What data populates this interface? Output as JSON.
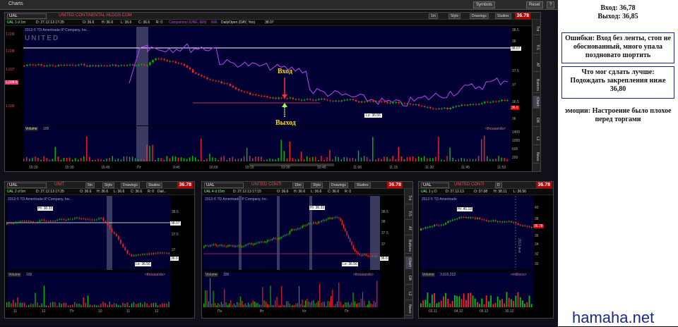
{
  "app": {
    "title": "Charts",
    "symbols_label": "Symbols",
    "reset_label": "Reset",
    "help_label": "?"
  },
  "main_panel": {
    "symbol": "UAL",
    "company": "UNITED CONTINENTAL HLDGS COM",
    "last_price": "36.78",
    "aggregation": "1m",
    "style_label": "Style",
    "drawings_label": "Drawings",
    "studies_label": "Studies",
    "info": {
      "period": "UAL 1 d 1m",
      "date": "D: 27.12.13 17:25",
      "open": "O: 36.6",
      "high": "H: 36.6",
      "low": "L: 36.6",
      "close": "C: 36.6",
      "r": "R: 0",
      "comparison": "Comparison (UNE, IEN)",
      "na": "N/A",
      "daily_open": "DailyOpen (DAY, Yes)",
      "daily_open_value": "38.07"
    },
    "copyright": "2013 © TD Ameritrade IP Company, Inc.",
    "watermark_text": "UNITED",
    "low_label": "Lo: 36.56",
    "volume_label": "Volume",
    "volume_value": "100",
    "thousands": "<thousands>",
    "left_price": "1,038.5",
    "time_ticks": [
      "15:20",
      "15:30",
      "15:45",
      "Пт",
      "9:45",
      "10:00",
      "10:15",
      "10:30",
      "10:45",
      "11:00",
      "11:15",
      "11:30",
      "11:45",
      "11:53"
    ],
    "price_ticks": [
      "38.5",
      "38",
      "38.07",
      "37.5",
      "37",
      "36.5",
      "36.6",
      "36"
    ],
    "left_ticks": [
      "1,039",
      "1,038",
      "1,037",
      "1,036",
      "1,035"
    ],
    "vol_ticks": [
      "1400",
      "1200",
      "1000",
      "800",
      "600",
      "400",
      "200",
      "100"
    ],
    "side_tabs": [
      "Trd",
      "TIS",
      "AT",
      "Buttons",
      "Chart",
      "DB",
      "L2",
      "News"
    ],
    "annotation_entry": "Вход",
    "annotation_exit": "Выход"
  },
  "panel_2d": {
    "symbol": "UAL",
    "company": "UNIT",
    "last_price": "36.78",
    "aggregation": "5m",
    "style_label": "Style",
    "drawings_label": "Drawings",
    "studies_label": "Studies",
    "info": {
      "period": "UAL 2 d 5m",
      "date": "D: 27.12.13 17:25",
      "open": "O: 36.6",
      "high": "H: 36.6",
      "low": "L: 36.6",
      "close": "C: 36.6",
      "r": "R: 0",
      "extra": "Dail..."
    },
    "copyright": "2013 © TD Ameritrade IP Company, Inc.",
    "high_label": "Hi: 38.33",
    "low_label": "Lo: 36.56",
    "volume_label": "Volume",
    "volume_value": "100",
    "thousands": "<thousands>",
    "time_ticks": [
      "11",
      "12",
      "Пт",
      "10",
      "11",
      "12"
    ],
    "price_ticks": [
      "38.5",
      "38.07",
      "37.5",
      "37",
      "36.5",
      "36.6"
    ]
  },
  "panel_4d": {
    "symbol": "UAL",
    "company": "UNITED CONTI",
    "last_price": "36.78",
    "aggregation": "15m",
    "style_label": "Style",
    "drawings_label": "Drawings",
    "studies_label": "Studies",
    "info": {
      "period": "UAL 4 d 15m",
      "date": "D: 27.12.13 17:15",
      "open": "O: 36.6",
      "high": "H: 36.6",
      "low": "L: 36.6",
      "close": "C: 36.6",
      "r": "R: 0"
    },
    "copyright": "2013 © TD Ameritrade IP Company, Inc.",
    "high_label": "Hi: 38.33",
    "low_label": "Lo: 36.56",
    "volume_label": "Volume",
    "volume_value": "100",
    "thousands": "<thousands>",
    "time_ticks": [
      "Пн",
      "Вт",
      "Чт",
      "Пт"
    ],
    "price_ticks": [
      "38.5",
      "38",
      "37.5",
      "37",
      "36.5",
      "36.6"
    ],
    "side_tabs": [
      "Trd",
      "TIS",
      "AT",
      "Buttons",
      "Chart",
      "DB",
      "L2",
      "News"
    ]
  },
  "panel_1y": {
    "symbol": "UAL",
    "company": "UNITED CONTI",
    "last_price": "36.78",
    "aggregation": "D",
    "style_label": "Style",
    "drawings_label": "Drawings",
    "studies_label": "Studies",
    "info": {
      "period": "UAL 1 y D",
      "date": "D: 27.12.13",
      "open": "O: 37.08",
      "high": "H: 38.11",
      "low": "L: 36.56"
    },
    "copyright": "2013 © TD Ameritrade",
    "high_label": "Hi: 40.19",
    "year_label": "2013 янв",
    "volume_label": "Volume",
    "volume_value": "3,615,222",
    "millions": "<millions>",
    "time_ticks": [
      "02.11",
      "04.12",
      "05.12",
      "30.12"
    ],
    "price_ticks": [
      "40",
      "38",
      "36.78",
      "36",
      "34",
      "32",
      "30"
    ]
  },
  "notes": {
    "entry_exit": [
      "Вход: 36,78",
      "Выход: 36,85"
    ],
    "mistakes": "Ошибки: Вход без ленты, стоп не обоснованный, много упала поздновато шортить",
    "improve": "Что мог сдлать лучше: Подождать закрепления ниже 36,80",
    "emotions": "эмоции: Настроение было плохое перед торгами",
    "site": "hamaha.net"
  },
  "colors": {
    "background": "#000033",
    "up_candle": "#00c000",
    "down_candle": "#ff2020",
    "comparison": "#c040ff",
    "dailyopen": "#ffffff",
    "annotation": "#ffd700",
    "note_border": "#1a2a8a"
  }
}
